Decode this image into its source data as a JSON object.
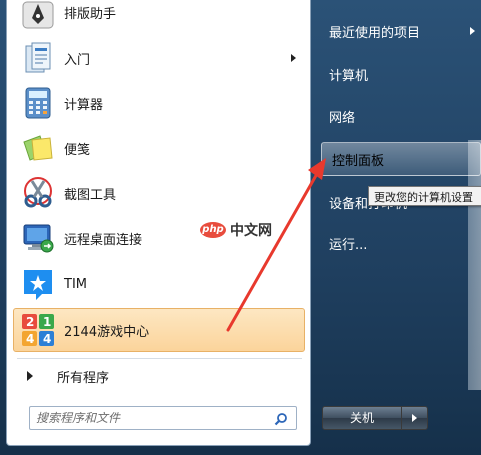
{
  "left_programs": [
    {
      "label": "排版助手",
      "icon": "typesetting-assistant-icon"
    },
    {
      "label": "入门",
      "icon": "getting-started-icon",
      "has_submenu": true
    },
    {
      "label": "计算器",
      "icon": "calculator-icon"
    },
    {
      "label": "便笺",
      "icon": "sticky-notes-icon"
    },
    {
      "label": "截图工具",
      "icon": "snipping-tool-icon"
    },
    {
      "label": "远程桌面连接",
      "icon": "remote-desktop-icon"
    },
    {
      "label": "TIM",
      "icon": "tim-icon"
    },
    {
      "label": "2144游戏中心",
      "icon": "game-center-icon",
      "highlighted": true
    }
  ],
  "all_programs": {
    "label": "所有程序"
  },
  "search": {
    "placeholder": "搜索程序和文件"
  },
  "right_items": [
    {
      "label": "最近使用的项目",
      "has_submenu": true
    },
    {
      "label": "计算机"
    },
    {
      "label": "网络"
    },
    {
      "label": "控制面板",
      "highlighted": true
    },
    {
      "label": "设备和打印机"
    },
    {
      "label": "运行..."
    }
  ],
  "tooltip": {
    "text": "更改您的计算机设置"
  },
  "shutdown": {
    "label": "关机"
  },
  "watermark": {
    "logo": "php",
    "text": "中文网"
  },
  "colors": {
    "annotation_arrow": "#e8392d",
    "highlight": "#fbd49b"
  }
}
